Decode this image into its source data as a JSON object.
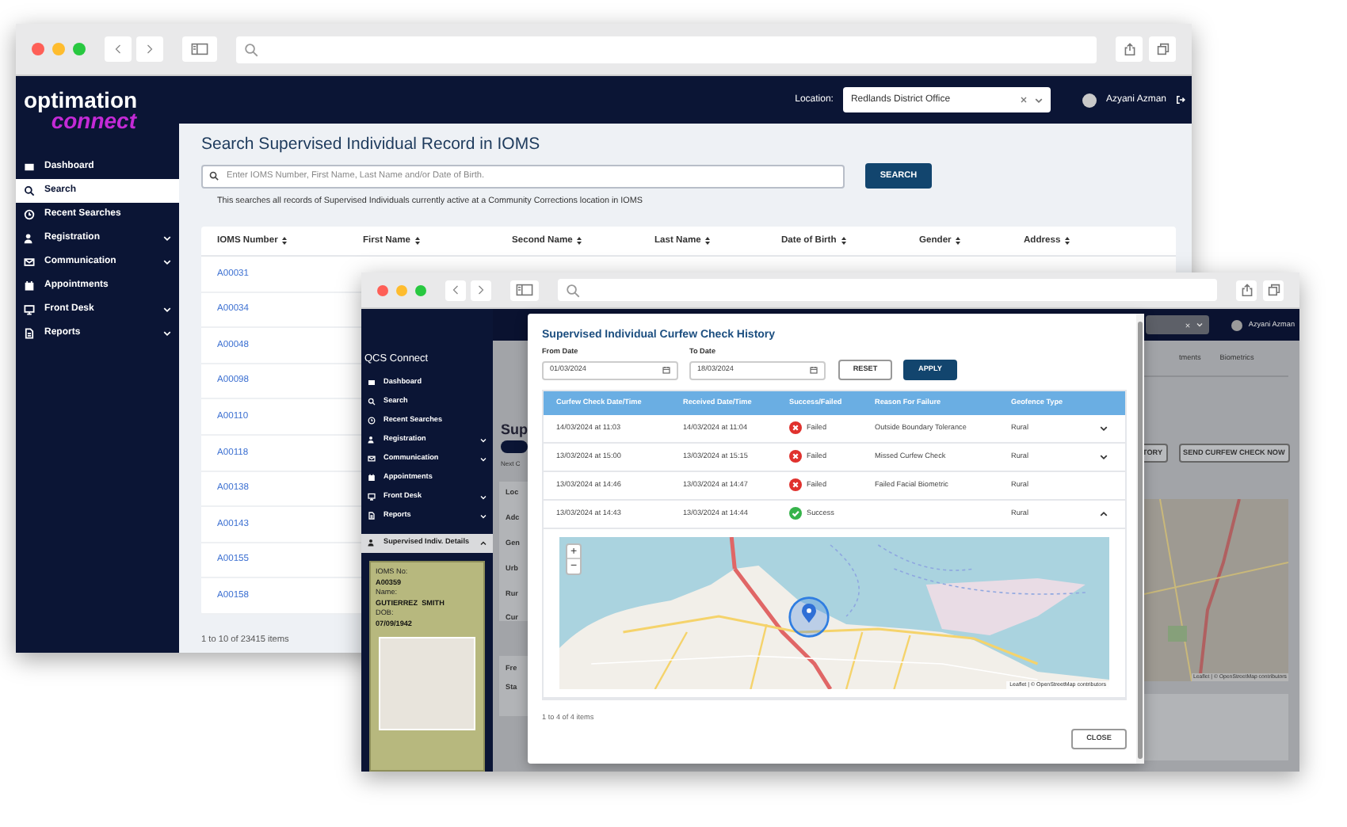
{
  "back_window": {
    "sidebar": {
      "logo": {
        "line_1": "optimation",
        "line_2": "connect"
      },
      "items": [
        {
          "label": "Dashboard",
          "selected": false,
          "expandable": false
        },
        {
          "label": "Search",
          "selected": true,
          "expandable": false
        },
        {
          "label": "Recent Searches",
          "selected": false,
          "expandable": false
        },
        {
          "label": "Registration",
          "selected": false,
          "expandable": true
        },
        {
          "label": "Communication",
          "selected": false,
          "expandable": true
        },
        {
          "label": "Appointments",
          "selected": false,
          "expandable": false
        },
        {
          "label": "Front Desk",
          "selected": false,
          "expandable": true
        },
        {
          "label": "Reports",
          "selected": false,
          "expandable": true
        }
      ]
    },
    "header": {
      "location_label": "Location:",
      "location_value": "Redlands District Office",
      "user": "Azyani Azman"
    },
    "title": "Search Supervised Individual Record in IOMS",
    "search": {
      "placeholder": "Enter IOMS Number, First Name, Last Name and/or Date of Birth.",
      "button": "SEARCH",
      "hint": "This searches all records of Supervised Individuals currently active at a Community Corrections location in IOMS"
    },
    "table": {
      "columns": [
        "IOMS Number",
        "First Name",
        "Second Name",
        "Last Name",
        "Date of Birth",
        "Gender",
        "Address"
      ],
      "rows": [
        {
          "ioms_number": "A00031"
        },
        {
          "ioms_number": "A00034"
        },
        {
          "ioms_number": "A00048"
        },
        {
          "ioms_number": "A00098"
        },
        {
          "ioms_number": "A00110"
        },
        {
          "ioms_number": "A00118"
        },
        {
          "ioms_number": "A00138"
        },
        {
          "ioms_number": "A00143"
        },
        {
          "ioms_number": "A00155"
        },
        {
          "ioms_number": "A00158"
        }
      ]
    },
    "pagination": "1 to 10 of 23415 items"
  },
  "front_window": {
    "sidebar": {
      "title": "QCS Connect",
      "items": [
        {
          "label": "Dashboard",
          "selected": false,
          "expandable": false
        },
        {
          "label": "Search",
          "selected": false,
          "expandable": false
        },
        {
          "label": "Recent Searches",
          "selected": false,
          "expandable": false
        },
        {
          "label": "Registration",
          "selected": false,
          "expandable": true
        },
        {
          "label": "Communication",
          "selected": false,
          "expandable": true
        },
        {
          "label": "Appointments",
          "selected": false,
          "expandable": false
        },
        {
          "label": "Front Desk",
          "selected": false,
          "expandable": true
        },
        {
          "label": "Reports",
          "selected": false,
          "expandable": true
        }
      ],
      "section": {
        "label": "Supervised Indiv. Details",
        "expanded": true
      },
      "card": {
        "fields": [
          {
            "label": "IOMS No:",
            "value": "A00359"
          },
          {
            "label": "Name:",
            "value": "GUTIERREZ  SMITH"
          },
          {
            "label": "DOB:",
            "value": "07/09/1942"
          }
        ]
      }
    },
    "header": {
      "user": "Azyani Azman"
    },
    "page_behind": {
      "heading": "Sup",
      "toggle_on": true,
      "note": "Next C",
      "panel_1": [
        "Loc",
        "Adc",
        "Gen",
        "Urb",
        "Rur",
        "Cur"
      ],
      "panel_2": [
        "Fre",
        "Sta"
      ],
      "tabs": [
        "tments",
        "Biometrics"
      ],
      "buttons": [
        "TORY",
        "SEND CURFEW CHECK NOW"
      ],
      "map_attribution": "Leaflet | © OpenStreetMap contributors"
    },
    "modal": {
      "title": "Supervised Individual Curfew Check History",
      "from_date": {
        "label": "From Date",
        "value": "01/03/2024"
      },
      "to_date": {
        "label": "To Date",
        "value": "18/03/2024"
      },
      "reset": "RESET",
      "apply": "APPLY",
      "columns": [
        "Curfew Check Date/Time",
        "Received Date/Time",
        "Success/Failed",
        "Reason For Failure",
        "Geofence Type"
      ],
      "rows": [
        {
          "check_time": "14/03/2024 at 11:03",
          "received_time": "14/03/2024 at 11:04",
          "result": {
            "kind": "failed",
            "label": "Failed"
          },
          "reason": "Outside Boundary Tolerance",
          "geofence": "Rural",
          "expandable": true,
          "expanded": false
        },
        {
          "check_time": "13/03/2024 at 15:00",
          "received_time": "13/03/2024 at 15:15",
          "result": {
            "kind": "failed",
            "label": "Failed"
          },
          "reason": "Missed Curfew Check",
          "geofence": "Rural",
          "expandable": true,
          "expanded": false
        },
        {
          "check_time": "13/03/2024 at 14:46",
          "received_time": "13/03/2024 at 14:47",
          "result": {
            "kind": "failed",
            "label": "Failed"
          },
          "reason": "Failed Facial Biometric",
          "geofence": "Rural",
          "expandable": false
        },
        {
          "check_time": "13/03/2024 at 14:43",
          "received_time": "13/03/2024 at 14:44",
          "result": {
            "kind": "success",
            "label": "Success"
          },
          "geofence": "Rural",
          "expandable": true,
          "expanded": true
        }
      ],
      "map": {
        "zoom_in": "+",
        "zoom_out": "−",
        "attribution": "Leaflet | © OpenStreetMap contributors"
      },
      "pagination": "1 to 4 of 4 items",
      "close": "CLOSE"
    }
  }
}
